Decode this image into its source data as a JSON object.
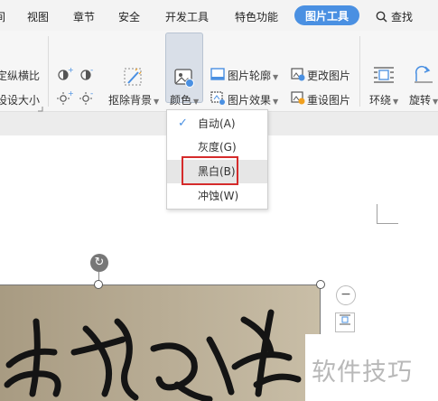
{
  "menu": {
    "tabs": [
      {
        "label": "间"
      },
      {
        "label": "视图"
      },
      {
        "label": "章节"
      },
      {
        "label": "安全"
      },
      {
        "label": "开发工具"
      },
      {
        "label": "特色功能"
      },
      {
        "label": "图片工具"
      },
      {
        "label": "查找"
      }
    ]
  },
  "ribbon": {
    "lock_ratio_label": "定纵横比",
    "reset_size_label": "设设大小",
    "remove_bg_label": "抠除背景",
    "color_label": "颜色",
    "outline_label": "图片轮廓",
    "effects_label": "图片效果",
    "change_pic_label": "更改图片",
    "reset_pic_label": "重设图片",
    "wrap_label": "环绕",
    "rotate_label": "旋转"
  },
  "color_menu": {
    "items": [
      {
        "label": "自动(A)",
        "checked": true
      },
      {
        "label": "灰度(G)",
        "checked": false
      },
      {
        "label": "黑白(B)",
        "checked": false
      },
      {
        "label": "冲蚀(W)",
        "checked": false
      }
    ],
    "highlighted_index": 2
  },
  "watermark": {
    "text": "软件技巧"
  },
  "colors": {
    "accent": "#4a90e2",
    "highlight": "#d52b2b"
  }
}
